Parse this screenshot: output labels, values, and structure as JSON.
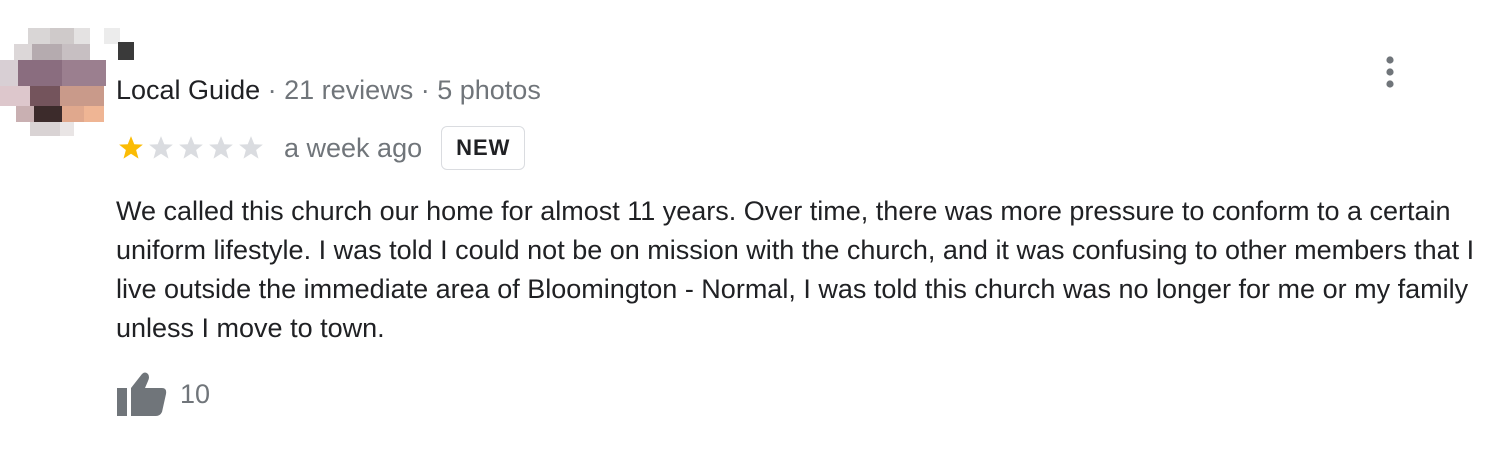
{
  "reviewer": {
    "badge_label": "Local Guide",
    "separator": "·",
    "reviews_count": "21 reviews",
    "photos_count": "5 photos"
  },
  "rating": {
    "stars": 1,
    "max_stars": 5,
    "filled_color": "#fbbc04",
    "empty_color": "#dadce0"
  },
  "time_ago": "a week ago",
  "new_badge": "NEW",
  "review_text": "We called this church our home for almost 11 years. Over time, there was more pressure to conform to a certain uniform lifestyle. I was told I could not be on mission with the church, and it was confusing to other members that I live outside the immediate area of Bloomington - Normal, I was told this church was no longer for me or my family unless I move to town.",
  "likes": {
    "count": "10",
    "icon": "thumbs-up-icon"
  },
  "menu_icon": "more-vert-icon"
}
